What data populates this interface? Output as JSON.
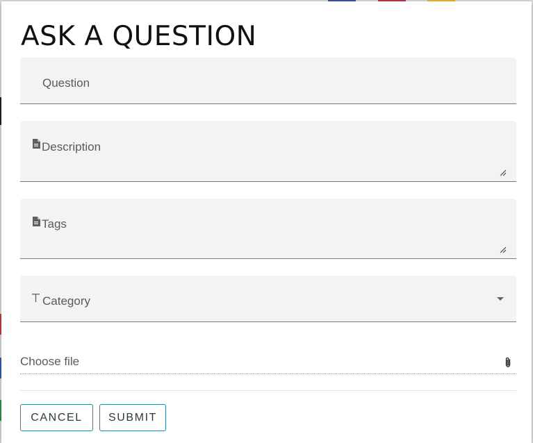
{
  "dialog": {
    "title": "ASK A QUESTION",
    "fields": {
      "question": {
        "label": "Question"
      },
      "description": {
        "label": "Description",
        "icon": "document-icon"
      },
      "tags": {
        "label": "Tags",
        "icon": "document-icon"
      },
      "category": {
        "label": "Category",
        "icon": "text-type-icon",
        "selected_value": ""
      }
    },
    "file": {
      "label": "Choose file",
      "icon": "paperclip-icon"
    },
    "buttons": {
      "cancel_label": "CANCEL",
      "submit_label": "SUBMIT"
    }
  },
  "colors": {
    "button_border": "#2c7d98",
    "field_background": "#f3f3f3"
  }
}
